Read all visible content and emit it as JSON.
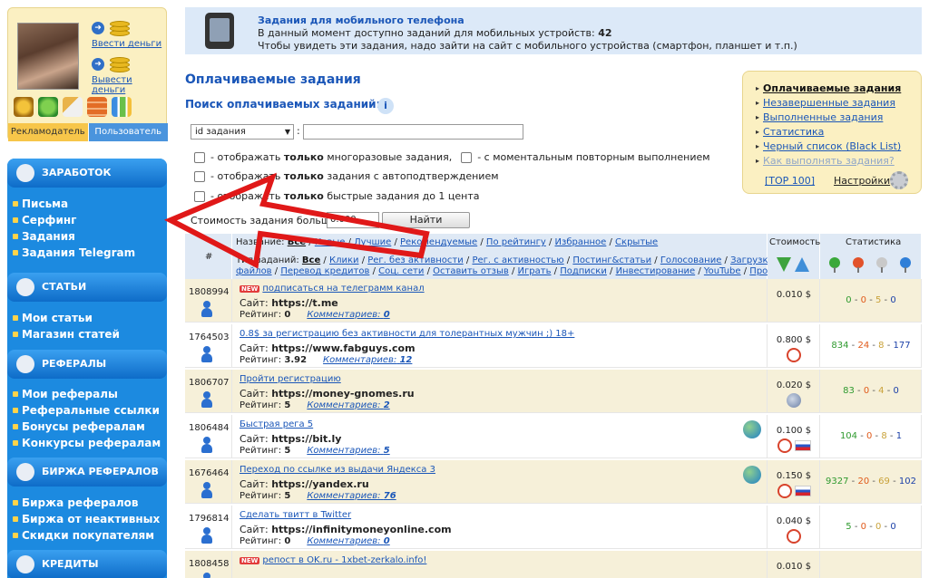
{
  "user_box": {
    "deposit_label": "Ввести деньги",
    "withdraw_label": "Вывести деньги",
    "tab_advertiser": "Рекламодатель",
    "tab_user": "Пользователь"
  },
  "sidebar": {
    "sections": [
      {
        "title": "ЗАРАБОТОК",
        "items": [
          "Письма",
          "Серфинг",
          "Задания",
          "Задания Telegram"
        ]
      },
      {
        "title": "СТАТЬИ",
        "items": [
          "Мои статьи",
          "Магазин статей"
        ]
      },
      {
        "title": "РЕФЕРАЛЫ",
        "items": [
          "Мои рефералы",
          "Реферальные ссылки",
          "Бонусы рефералам",
          "Конкурсы рефералам"
        ]
      },
      {
        "title": "БИРЖА РЕФЕРАЛОВ",
        "items": [
          "Биржа рефералов",
          "Биржа от неактивных",
          "Скидки покупателям"
        ]
      },
      {
        "title": "КРЕДИТЫ",
        "items": []
      }
    ]
  },
  "banner": {
    "title": "Задания для мобильного телефона",
    "line1_prefix": "В данный момент доступно заданий для мобильных устройств:",
    "line1_count": "42",
    "line2": "Чтобы увидеть эти задания, надо зайти на сайт с мобильного устройства (смартфон, планшет и т.п.)"
  },
  "main": {
    "title": "Оплачиваемые задания",
    "search_title": "Поиск оплачиваемых заданий:",
    "search_select_value": "id задания",
    "options": [
      {
        "pre": "- отображать ",
        "bold": "только",
        "post": " многоразовые задания,",
        "extra_pre": "- с моментальным повторным выполнением"
      },
      {
        "pre": "- отображать ",
        "bold": "только",
        "post": " задания с автоподтверждением"
      },
      {
        "pre": "- отображать ",
        "bold": "только",
        "post": " быстрые задания до 1 цента"
      }
    ],
    "cost_label": "Стоимость задания больше",
    "cost_value": "0.000",
    "find_button": "Найти"
  },
  "right_box": {
    "links": [
      "Оплачиваемые задания",
      "Незавершенные задания",
      "Выполненные задания",
      "Статистика",
      "Черный список (Black List)",
      "Как выполнять задания?"
    ],
    "top100": "[TOP 100]",
    "settings": "Настройки"
  },
  "table": {
    "headers": {
      "num": "#",
      "cost": "Стоимость",
      "stat": "Статистика",
      "name_prefix": "Название:",
      "name_links": [
        "Все",
        "Новые",
        "Лучшие",
        "Рекомендуемые",
        "По рейтингу",
        "Избранное",
        "Скрытые"
      ],
      "type_prefix": "Тип заданий:",
      "type_links_1": [
        "Все",
        "Клики",
        "Рег. без активности",
        "Рег. с активностью",
        "Постинг&статьи",
        "Голосование",
        "Загрузка"
      ],
      "type_links_2": [
        "файлов",
        "Перевод кредитов",
        "Соц. сети",
        "Оставить отзыв",
        "Играть",
        "Подписки",
        "Инвестирование",
        "YouTube",
        "Прочее"
      ]
    },
    "site_label": "Сайт:",
    "rating_label": "Рейтинг:",
    "comments_label": "Комментариев:",
    "rows": [
      {
        "id": "1808994",
        "new": true,
        "title": "подписаться на телеграмм канал",
        "site": "https://t.me",
        "rating": "0",
        "comments": "0",
        "price": "0.010 $",
        "stats": [
          "0",
          "0",
          "5",
          "0"
        ],
        "clock": false,
        "globe": false,
        "flag": false,
        "earth": false
      },
      {
        "id": "1764503",
        "new": false,
        "title": "0.8$ за регистрацию без активности для толерантных мужчин ;) 18+",
        "site": "https://www.fabguys.com",
        "rating": "3.92",
        "comments": "12",
        "price": "0.800 $",
        "stats": [
          "834",
          "24",
          "8",
          "177"
        ],
        "clock": true,
        "globe": false,
        "flag": false,
        "earth": false
      },
      {
        "id": "1806707",
        "new": false,
        "title": "Пройти регистрацию",
        "site": "https://money-gnomes.ru",
        "rating": "5",
        "comments": "2",
        "price": "0.020 $",
        "stats": [
          "83",
          "0",
          "4",
          "0"
        ],
        "clock": false,
        "globe": true,
        "flag": false,
        "earth": false
      },
      {
        "id": "1806484",
        "new": false,
        "title": "Быстрая рега 5",
        "site": "https://bit.ly",
        "rating": "5",
        "comments": "5",
        "price": "0.100 $",
        "stats": [
          "104",
          "0",
          "8",
          "1"
        ],
        "clock": true,
        "globe": false,
        "flag": true,
        "earth": true
      },
      {
        "id": "1676464",
        "new": false,
        "title": "Переход по ссылке из выдачи Яндекса 3",
        "site": "https://yandex.ru",
        "rating": "5",
        "comments": "76",
        "price": "0.150 $",
        "stats": [
          "9327",
          "20",
          "69",
          "102"
        ],
        "clock": true,
        "globe": false,
        "flag": true,
        "earth": true
      },
      {
        "id": "1796814",
        "new": false,
        "title": "Сделать твитт в Twitter",
        "site": "https://infinitymoneyonline.com",
        "rating": "0",
        "comments": "0",
        "price": "0.040 $",
        "stats": [
          "5",
          "0",
          "0",
          "0"
        ],
        "clock": true,
        "globe": false,
        "flag": false,
        "earth": false
      },
      {
        "id": "1808458",
        "new": true,
        "title": "репост в OK.ru - 1xbet-zerkalo.info!",
        "site": "",
        "rating": "",
        "comments": "",
        "price": "0.010 $",
        "stats": [
          "",
          "",
          "",
          ""
        ],
        "clock": false,
        "globe": false,
        "flag": false,
        "earth": false
      }
    ]
  },
  "colors": {
    "accent_blue": "#1a56b8",
    "sidebar_blue": "#1c8ae0",
    "row_tint": "#f6f0d9",
    "arrow_red": "#e01818"
  }
}
